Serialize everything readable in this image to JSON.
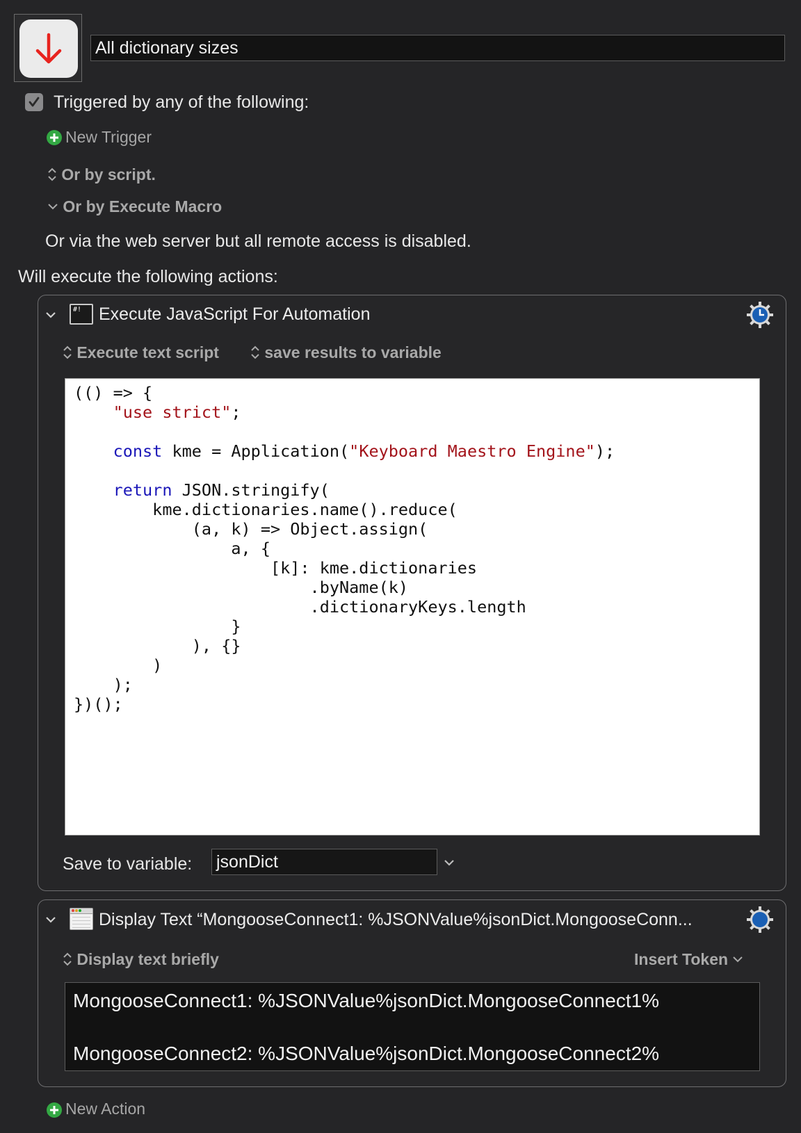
{
  "macro": {
    "name": "All dictionary sizes",
    "icon": "down-arrow-icon"
  },
  "triggers": {
    "heading": "Triggered by any of the following:",
    "checked": true,
    "new_trigger": "New Trigger",
    "or_by_script": "Or by script.",
    "or_by_execute_macro": "Or by Execute Macro",
    "web_server_note": "Or via the web server but all remote access is disabled."
  },
  "actions": {
    "heading": "Will execute the following actions:",
    "new_action": "New Action",
    "jxa": {
      "title": "Execute JavaScript For Automation",
      "option_mode": "Execute text script",
      "option_results": "save results to variable",
      "code_lines": [
        "(() => {",
        "    \"use strict\";",
        "",
        "    const kme = Application(\"Keyboard Maestro Engine\");",
        "",
        "    return JSON.stringify(",
        "        kme.dictionaries.name().reduce(",
        "            (a, k) => Object.assign(",
        "                a, {",
        "                    [k]: kme.dictionaries",
        "                        .byName(k)",
        "                        .dictionaryKeys.length",
        "                }",
        "            ), {}",
        "        )",
        "    );",
        "})();"
      ],
      "save_to_label": "Save to variable:",
      "save_to_value": "jsonDict"
    },
    "display": {
      "title": "Display Text “MongooseConnect1: %JSONValue%jsonDict.MongooseConn...",
      "option_mode": "Display text briefly",
      "insert_token": "Insert Token",
      "text_lines": [
        "MongooseConnect1: %JSONValue%jsonDict.MongooseConnect1%",
        "",
        "MongooseConnect2: %JSONValue%jsonDict.MongooseConnect2%"
      ]
    }
  },
  "colors": {
    "background": "#252527",
    "accent_green": "#33a843",
    "accent_blue": "#1a5fb4",
    "arrow_red": "#e8231e"
  }
}
